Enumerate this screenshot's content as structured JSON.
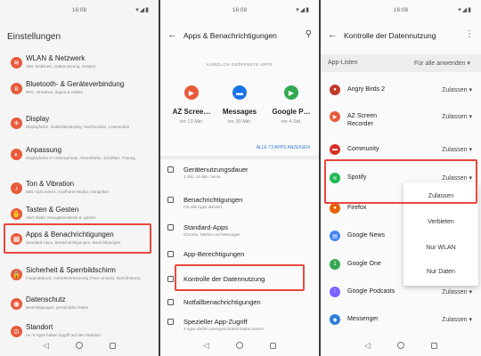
{
  "status": {
    "time": "16:08",
    "icons": "▾◢▮"
  },
  "panel1": {
    "title": "Einstellungen",
    "items": [
      {
        "label": "WLAN & Netzwerk",
        "sub": "SIM, Mobilnetz, Datennutzung, Hotspot",
        "icon": "wifi-icon",
        "glyph": "≋"
      },
      {
        "label": "Bluetooth- & Geräteverbindung",
        "sub": "NFC, streamen, tippen & zahlen",
        "icon": "bluetooth-icon",
        "glyph": "ʙ"
      },
      {
        "label": "Display",
        "sub": "Displayfarbe, Inaktivitätsdisplay, Nachtmodus, Lesemodus",
        "icon": "display-icon",
        "glyph": "☀"
      },
      {
        "label": "Anpassung",
        "sub": "Displayfarbe im Hintergründe, Akzentfarbe, Schriftart, Tönung",
        "icon": "palette-icon",
        "glyph": "◐"
      },
      {
        "label": "Ton & Vibration",
        "sub": "Bitte nicht stören, Kopfhörer-Modus, Klingelton",
        "icon": "sound-icon",
        "glyph": "♪"
      },
      {
        "label": "Tasten & Gesten",
        "sub": "Alert Slider, Navigationsleiste & -gesten",
        "icon": "gesture-icon",
        "glyph": "✋"
      },
      {
        "label": "Apps & Benachrichtigungen",
        "sub": "Standard-Apps, Benachrichtigungen, Berechtigungen",
        "icon": "apps-icon",
        "glyph": "▦"
      },
      {
        "label": "Sicherheit & Sperrbildschirm",
        "sub": "Fingerabdruck, Gesichtserkennung (Face Unlock), Notrufrettung",
        "icon": "lock-icon",
        "glyph": "🔒"
      },
      {
        "label": "Datenschutz",
        "sub": "Berechtigungen, persönliche Daten",
        "icon": "privacy-icon",
        "glyph": "◉"
      },
      {
        "label": "Standort",
        "sub": "An: 5 Apps haben Zugriff auf den Standort",
        "icon": "location-icon",
        "glyph": "⊙"
      }
    ]
  },
  "panel2": {
    "title": "Apps & Benachrichtigungen",
    "recent_header": "KÜRZLICH GEÖFFNETE APPS",
    "recent": [
      {
        "name": "AZ Scree…",
        "time": "vor 13 Min.",
        "color": "#e85a3b",
        "icon": "camera-icon",
        "glyph": "▶"
      },
      {
        "name": "Messages",
        "time": "vor 30 Min.",
        "color": "#1a73e8",
        "icon": "messages-icon",
        "glyph": "▬"
      },
      {
        "name": "Google P…",
        "time": "vor 4 Std.",
        "color": "#34a853",
        "icon": "play-store-icon",
        "glyph": "▶"
      }
    ],
    "show_all": "ALLE 73 APPS ANZEIGEN",
    "menu": [
      {
        "label": "Gerätenutzungsdauer",
        "sub": "1 Std., 23 Min. heute"
      },
      {
        "label": "Benachrichtigungen",
        "sub": "Für alle Apps aktiviert"
      },
      {
        "label": "Standard-Apps",
        "sub": "Chrome, Telefon und Messages"
      },
      {
        "label": "App-Berechtigungen",
        "sub": ""
      },
      {
        "label": "Kontrolle der Datennutzung",
        "sub": ""
      },
      {
        "label": "Notfallbenachrichtigungen",
        "sub": ""
      },
      {
        "label": "Spezieller App-Zugriff",
        "sub": "2 Apps dürfen uneingeschränkt Daten nutzen"
      }
    ]
  },
  "panel3": {
    "title": "Kontrolle der Datennutzung",
    "list_label": "App-Listen",
    "filter": "Für alle anwenden ▾",
    "apps": [
      {
        "name": "Angry Birds 2",
        "perm": "Zulassen ▾",
        "color": "#c0392b",
        "icon": "angry-birds-icon",
        "glyph": "●"
      },
      {
        "name": "AZ Screen\nRecorder",
        "perm": "Zulassen ▾",
        "color": "#e85a3b",
        "icon": "recorder-icon",
        "glyph": "▶"
      },
      {
        "name": "Community",
        "perm": "Zulassen ▾",
        "color": "#d93025",
        "icon": "community-icon",
        "glyph": "▬"
      },
      {
        "name": "Spotify",
        "perm": "Zulassen ▾",
        "color": "#1db954",
        "icon": "spotify-icon",
        "glyph": "≋"
      },
      {
        "name": "Firefox",
        "perm": "",
        "color": "#e66000",
        "icon": "firefox-icon",
        "glyph": "●"
      },
      {
        "name": "Google News",
        "perm": "",
        "color": "#4285f4",
        "icon": "google-news-icon",
        "glyph": "▤"
      },
      {
        "name": "Google One",
        "perm": "",
        "color": "#34a853",
        "icon": "google-one-icon",
        "glyph": "1"
      },
      {
        "name": "Google Podcasts",
        "perm": "Zulassen ▾",
        "color": "#7b61ff",
        "icon": "podcasts-icon",
        "glyph": "⁞"
      },
      {
        "name": "Messenger",
        "perm": "Zulassen ▾",
        "color": "#2e7ed6",
        "icon": "messenger-icon",
        "glyph": "◆"
      }
    ],
    "dropdown": [
      "Zulassen",
      "Verbieten",
      "Nur WLAN",
      "Nur Daten"
    ]
  },
  "colors": {
    "highlight": "#e8473e",
    "accent": "#2e7ed6"
  }
}
